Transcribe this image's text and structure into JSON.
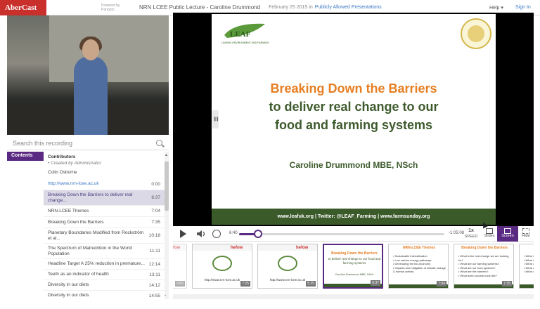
{
  "header": {
    "logo": "AberCast",
    "powered_by": "Powered by Panopto",
    "title": "NRN LCEE Public Lecture - Caroline Drummond",
    "date": "February 25 2015 in",
    "folder": "Publicly Allowed Presentations",
    "help": "Help ▾",
    "sign_in": "Sign In"
  },
  "search": {
    "placeholder": "Search this recording"
  },
  "sidebar": {
    "tab_contents": "Contents"
  },
  "contents": {
    "title": "Contributors",
    "subtitle": "• Created by Administrator",
    "name": "Colin Osborne",
    "items": [
      {
        "label": "http://www.nrn-lcee.ac.uk",
        "time": "0:00"
      },
      {
        "label": "Breaking Down the Barriers to deliver real change...",
        "time": "6:37"
      },
      {
        "label": "NRN-LCEE Themes",
        "time": "7:04"
      },
      {
        "label": "Breaking Down the Barriers",
        "time": "7:35"
      },
      {
        "label": "Planetary Boundaries Modified from Rockström et al...",
        "time": "10:18"
      },
      {
        "label": "The Spectrum of Malnutrition in the World Population",
        "time": "11:11"
      },
      {
        "label": "Headline Target A 25% reduction in premature...",
        "time": "12:14"
      },
      {
        "label": "Teeth as an indicator of health",
        "time": "13:11"
      },
      {
        "label": "Diversity in our diets",
        "time": "14:12"
      },
      {
        "label": "Diversity in our diets",
        "time": "14:55"
      }
    ]
  },
  "slide": {
    "logo_text": "LINKING ENVIRONMENT AND FARMING",
    "title_line1": "Breaking Down the Barriers",
    "title_line2": "to deliver real change to  our",
    "title_line3": "food and farming systems",
    "author": "Caroline Drummond MBE, NSch",
    "footer": "www.leafuk.org  |  Twitter: @LEAF_Farming  |  www.farmsunday.org",
    "handle": "▐▐"
  },
  "controls": {
    "current_time": "6:40",
    "remaining_time": "-1:05:08",
    "progress": 0.093,
    "speed_value": "1x",
    "speed_label": "SPEED",
    "slides_label": "Slides",
    "screen_label": "Screen",
    "hide_label": "Hide"
  },
  "thumbs": [
    {
      "time": "0:00",
      "url": ""
    },
    {
      "time": "7:25",
      "url": "http://www.nrn-lcee.ac.uk"
    },
    {
      "time": "5:25",
      "url": "http://www.nrn-lcee.ac.uk"
    },
    {
      "time": "6:37",
      "title": "Breaking Down the Barriers",
      "sub": "to deliver real change to  our food and farming systems",
      "author": "Caroline Drummond MBE, NSch"
    },
    {
      "time": "7:04",
      "title": "NRN-LCEE Themes",
      "bullets": "• Sustainable intensification\n• Low carbon energy pathways\n• Developing the bio-economy\n• Impacts and mitigation of climate change & human activity"
    },
    {
      "time": "7:35",
      "title": "Breaking Down the Barriers",
      "bullets": "• What is the real change we are looking for?\n• What are our farming systems?\n• What are our food systems?\n• What are the barriers?\n• What does success look like?"
    },
    {
      "time": "",
      "bullets": "• What is\n• What a\n• What a\n• What a\n• What d"
    }
  ],
  "thumb_logo": "hefow"
}
